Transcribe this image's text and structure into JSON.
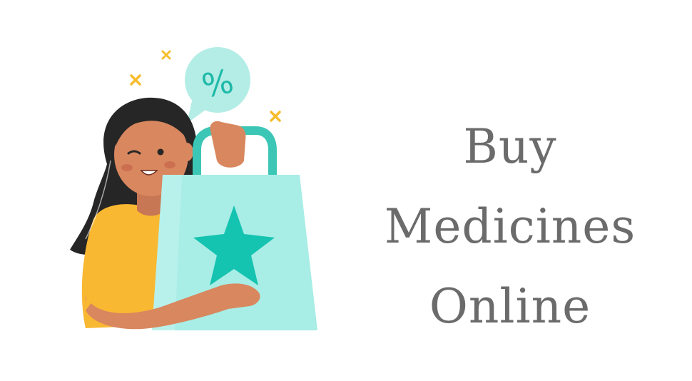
{
  "headline": {
    "line1": "Buy",
    "line2": "Medicines",
    "line3": "Online"
  },
  "illustration": {
    "speech_bubble_symbol": "%",
    "icons": [
      "sparkle-x-icon",
      "percent-speech-bubble-icon",
      "shopping-bag-icon",
      "star-icon"
    ]
  },
  "colors": {
    "bag": "#a8ede6",
    "bag_handle": "#3cc6b5",
    "star": "#14c3b0",
    "bubble": "#b3ede6",
    "bubble_text": "#1eb9a8",
    "sparkle": "#f7bd2e",
    "shirt": "#f9b832",
    "skin": "#d9875f",
    "hair": "#272626",
    "headline_text": "#6b6b6b"
  }
}
